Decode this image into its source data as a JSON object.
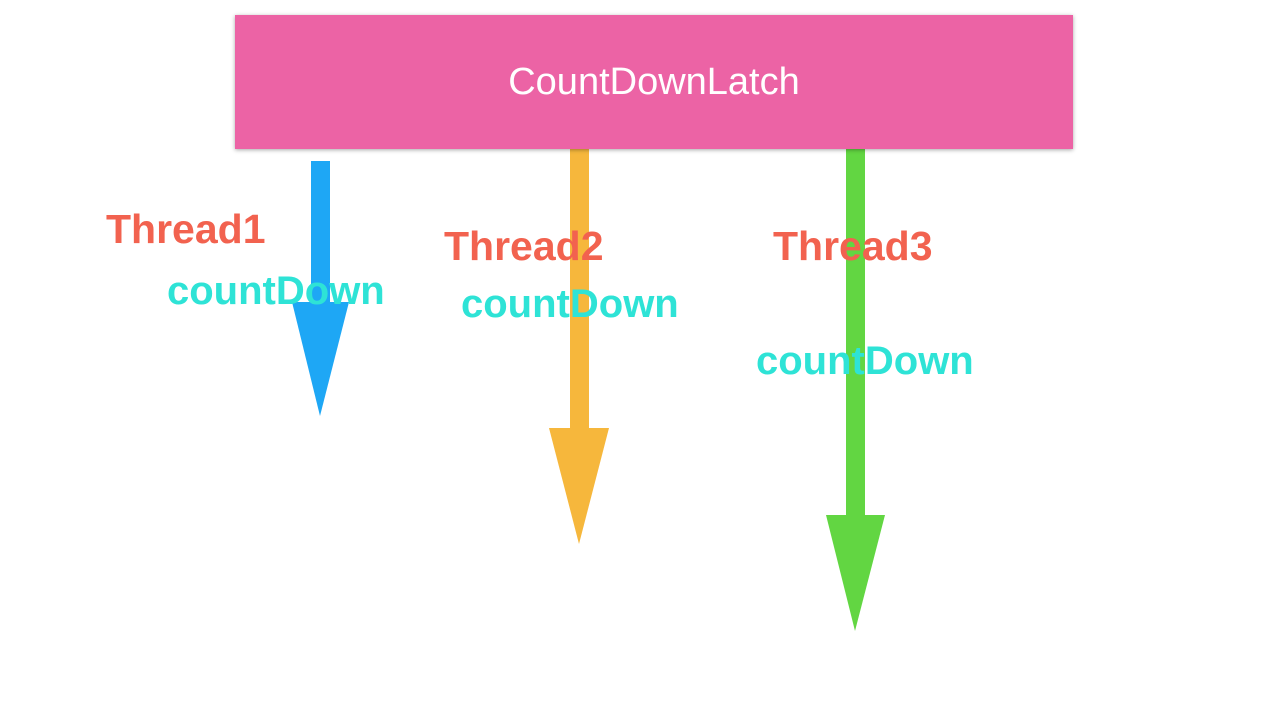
{
  "latch": {
    "title": "CountDownLatch",
    "color": "#ec63a5"
  },
  "threads": [
    {
      "label": "Thread1",
      "action": "countDown",
      "arrow_color": "#1ea7f5"
    },
    {
      "label": "Thread2",
      "action": "countDown",
      "arrow_color": "#f6b73c"
    },
    {
      "label": "Thread3",
      "action": "countDown",
      "arrow_color": "#62d642"
    }
  ],
  "colors": {
    "thread_label": "#f2624f",
    "count_down_label": "#2ee3d6"
  }
}
